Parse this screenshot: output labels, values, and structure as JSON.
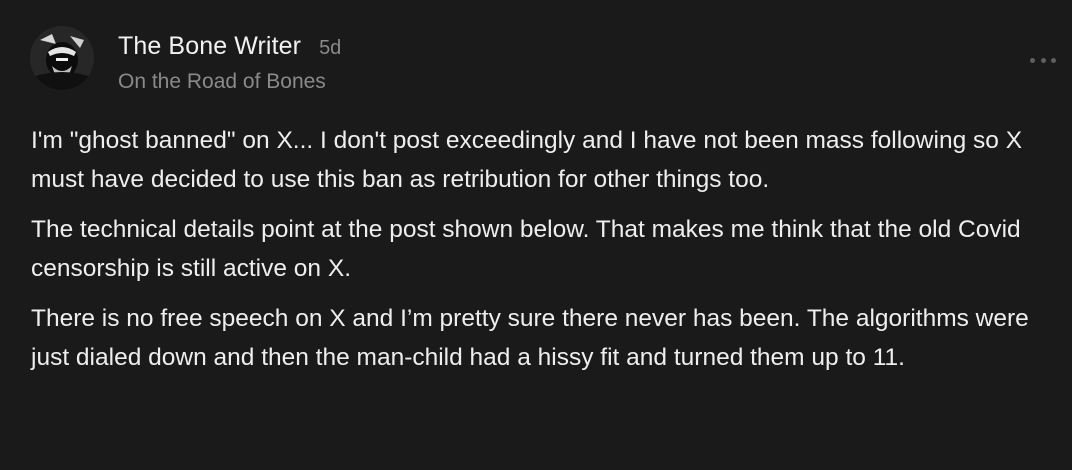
{
  "post": {
    "author": {
      "name": "The Bone Writer",
      "avatar_icon": "profile-photo"
    },
    "time": "5d",
    "publication": "On the Road of Bones",
    "more_icon": "more-horizontal-icon",
    "paragraphs": [
      "I'm \"ghost banned\" on X... I don't post exceedingly and I have not been mass following so X must have decided to use this ban as retribution for other things too.",
      "The technical details point at the post shown below. That makes me think that the old Covid censorship is still active on X.",
      "There is no free speech on X and I’m pretty sure there never has been. The algorithms were just dialed down and then the man-child had a hissy fit and turned them up to 11."
    ]
  },
  "colors": {
    "background": "#1a1a1b",
    "text_primary": "#eeeeee",
    "text_secondary": "#8a8a8e"
  }
}
